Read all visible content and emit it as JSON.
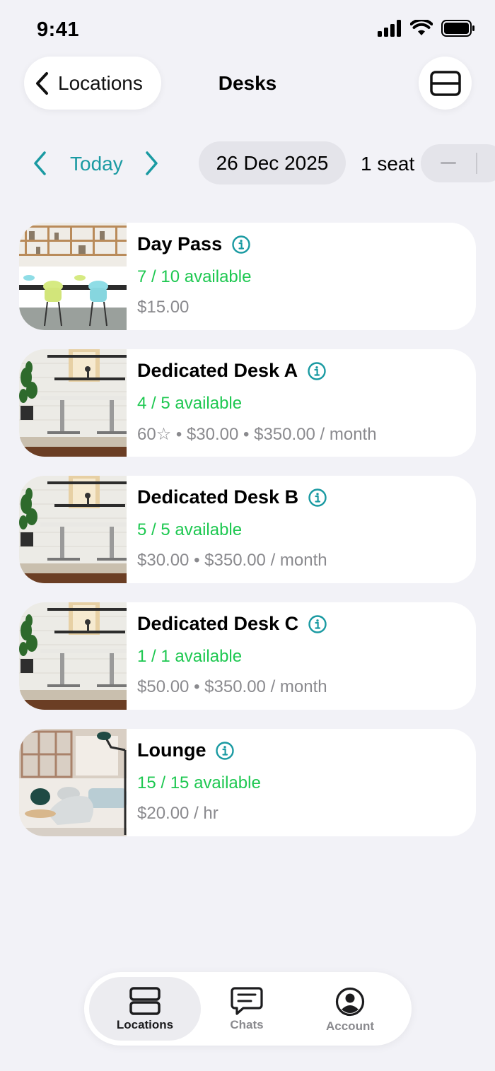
{
  "status_bar": {
    "time": "9:41",
    "icons": [
      "signal-icon",
      "wifi-icon",
      "battery-icon"
    ]
  },
  "nav": {
    "back_label": "Locations",
    "title": "Desks",
    "view_toggle_icon": "card-view-icon"
  },
  "date_bar": {
    "today_label": "Today",
    "date": "26 Dec 2025",
    "seats": "1 seat"
  },
  "desks": [
    {
      "title": "Day Pass",
      "available": "7 / 10 available",
      "price": "$15.00"
    },
    {
      "title": "Dedicated Desk A",
      "available": "4 / 5 available",
      "price": "60☆ • $30.00 • $350.00 / month"
    },
    {
      "title": "Dedicated Desk B",
      "available": "5 / 5 available",
      "price": "$30.00 • $350.00 / month"
    },
    {
      "title": "Dedicated Desk C",
      "available": "1 / 1 available",
      "price": "$50.00 • $350.00 / month"
    },
    {
      "title": "Lounge",
      "available": "15 / 15 available",
      "price": "$20.00 / hr"
    }
  ],
  "tabs": [
    {
      "label": "Locations",
      "icon": "locations-icon",
      "active": true
    },
    {
      "label": "Chats",
      "icon": "chat-icon",
      "active": false
    },
    {
      "label": "Account",
      "icon": "account-icon",
      "active": false
    }
  ],
  "colors": {
    "accent": "#1a9aa2",
    "available": "#1ec851",
    "background": "#f2f2f7",
    "muted": "#8a8a8e"
  }
}
